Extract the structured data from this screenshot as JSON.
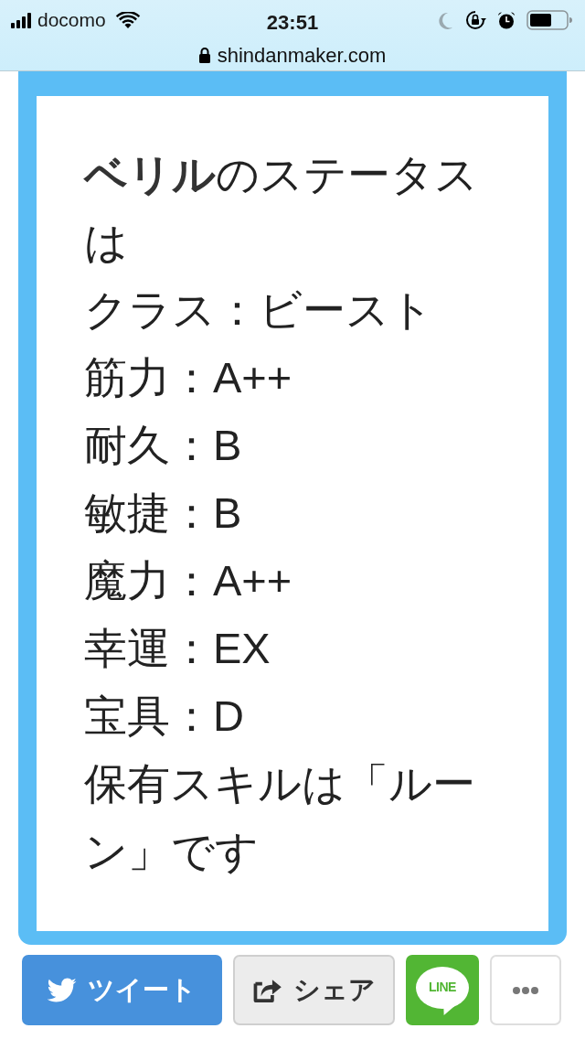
{
  "status_bar": {
    "carrier": "docomo",
    "time": "23:51",
    "url": "shindanmaker.com"
  },
  "result": {
    "lines": [
      "**ベリル**のステータスは",
      "クラス：ビースト",
      "筋力：A++",
      "耐久：B",
      "敏捷：B",
      "魔力：A++",
      "幸運：EX",
      "宝具：D",
      "保有スキルは「ルーン」です"
    ]
  },
  "share_buttons": [
    {
      "kind": "tweet",
      "label": "ツイート"
    },
    {
      "kind": "share",
      "label": "シェア"
    },
    {
      "kind": "line",
      "label": "LINE"
    },
    {
      "kind": "more"
    }
  ]
}
